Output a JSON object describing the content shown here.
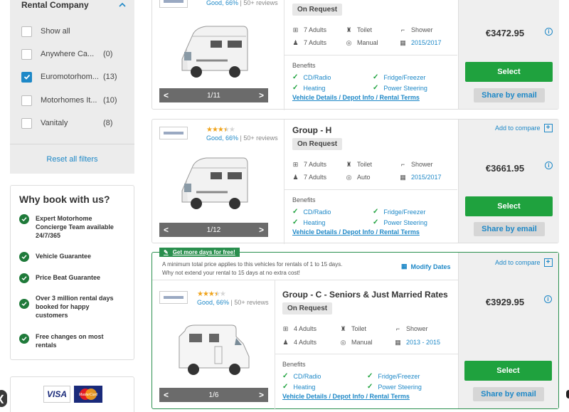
{
  "filter": {
    "title": "Rental Company",
    "options": [
      {
        "label": "Show all",
        "count": "",
        "checked": false
      },
      {
        "label": "Anywhere Ca...",
        "count": "(0)",
        "checked": false
      },
      {
        "label": "Euromotorhom...",
        "count": "(13)",
        "checked": true
      },
      {
        "label": "Motorhomes It...",
        "count": "(10)",
        "checked": false
      },
      {
        "label": "Vanitaly",
        "count": "(8)",
        "checked": false
      }
    ],
    "reset_label": "Reset all filters"
  },
  "why": {
    "title": "Why book with us?",
    "items": [
      "Expert Motorhome Concierge Team available 24/7/365",
      "Vehicle Guarantee",
      "Price Beat Guarantee",
      "Over 3 million rental days booked for happy customers",
      "Free changes on most rentals"
    ]
  },
  "payments": {
    "visa": "VISA",
    "mastercard": "MasterCard"
  },
  "common": {
    "rating_text": "Good, 66%",
    "reviews_text": "| 50+ reviews",
    "on_request": "On Request",
    "benefits_title": "Benefits",
    "benefits": [
      "CD/Radio",
      "Fridge/Freezer",
      "Heating",
      "Power Steering"
    ],
    "details_link": "Vehicle Details / Depot Info / Rental Terms",
    "select_label": "Select",
    "share_label": "Share by email",
    "compare_label": "Add to compare",
    "toilet": "Toilet",
    "shower": "Shower",
    "stars": 3.5
  },
  "listings": [
    {
      "group": "",
      "seats": "7 Adults",
      "sleeps": "7 Adults",
      "transmission": "Manual",
      "years": "2015/2017",
      "price": "€3472.95",
      "pager": "1/11"
    },
    {
      "group": "Group - H",
      "seats": "7 Adults",
      "sleeps": "7 Adults",
      "transmission": "Auto",
      "years": "2015/2017",
      "price": "€3661.95",
      "pager": "1/12"
    },
    {
      "group": "Group - C - Seniors & Just Married Rates",
      "seats": "4 Adults",
      "sleeps": "4 Adults",
      "transmission": "Manual",
      "years": "2013 - 2015",
      "price": "€3929.95",
      "pager": "1/6"
    }
  ],
  "promo": {
    "badge": "Get more days for free!",
    "note_line1": "A minimum total price applies to this vehicles for rentals of 1 to 15 days.",
    "note_line2": "Why not extend your rental to 15 days at no extra cost!",
    "modify_label": "Modify Dates"
  },
  "colors": {
    "accent": "#1e88c7",
    "select_green": "#1fa23e",
    "check_green": "#1f7a3a",
    "star": "#f0a41c"
  },
  "icons": [
    "chevron-up-icon",
    "checkbox-icon",
    "check-circle-icon",
    "seat-icon",
    "bed-icon",
    "toilet-icon",
    "shower-icon",
    "gear-icon",
    "calendar-icon",
    "info-icon",
    "compare-icon",
    "camper-icon",
    "arrow-left-icon",
    "arrow-right-icon"
  ]
}
